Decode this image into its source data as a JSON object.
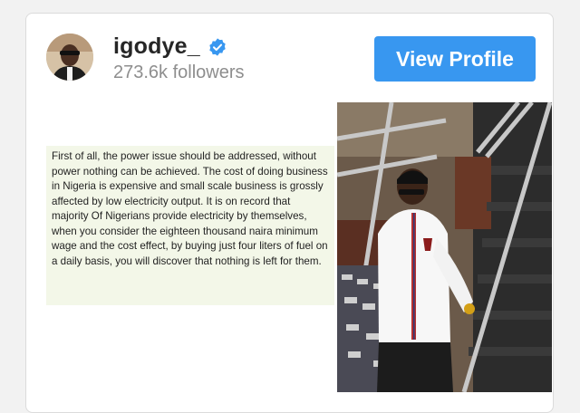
{
  "profile": {
    "username": "igodye_",
    "followers": "273.6k followers",
    "button_label": "View Profile",
    "verified": true,
    "avatar_icon": "profile-avatar"
  },
  "post": {
    "quote_text": "First of all, the power issue should be addressed, without power nothing can be achieved. The cost of doing business in Nigeria is expensive and small scale business is grossly affected by low electricity output. It is on record that majority Of Nigerians provide electricity by themselves, when you consider the eighteen thousand naira minimum wage and the cost effect, by buying just four liters of fuel on a daily basis, you will discover that nothing is left for them."
  },
  "colors": {
    "button": "#3897f0",
    "verified_badge": "#3897f0",
    "username": "#262626",
    "followers": "#8e8e8e",
    "quote_background": "#f3f7e8"
  }
}
